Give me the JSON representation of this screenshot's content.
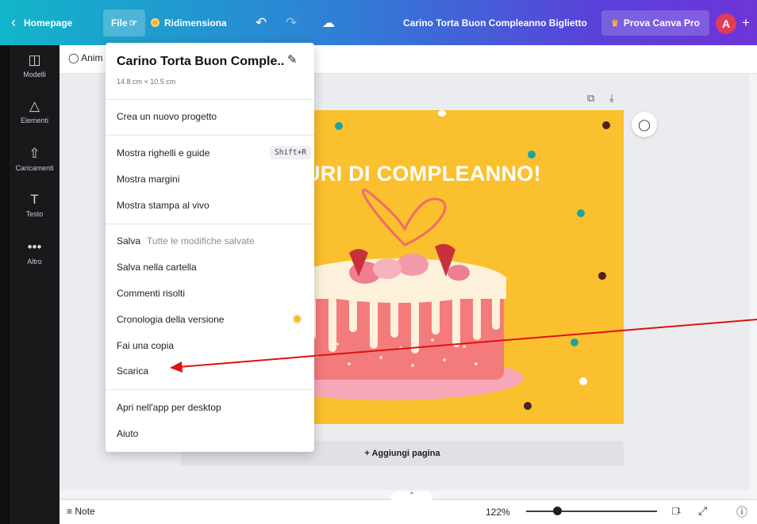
{
  "topbar": {
    "home_label": "Homepage",
    "file_label": "File",
    "resize_label": "Ridimensiona",
    "design_title": "Carino Torta Buon Compleanno Biglietto",
    "pro_label": "Prova Canva Pro",
    "avatar_initial": "A",
    "plus": "+"
  },
  "sidebar": {
    "items": [
      {
        "label": "Modelli",
        "icon": "layout-icon"
      },
      {
        "label": "Elementi",
        "icon": "shapes-icon"
      },
      {
        "label": "Caricamenti",
        "icon": "upload-icon"
      },
      {
        "label": "Testo",
        "icon": "text-icon"
      },
      {
        "label": "Altro",
        "icon": "more-icon"
      }
    ]
  },
  "subbar": {
    "animate_label": "Anim"
  },
  "menu": {
    "title": "Carino Torta Buon Comple..",
    "size": "14.8 cm × 10.5 cm",
    "items": [
      {
        "label": "Crea un nuovo progetto"
      },
      {
        "label": "Mostra righelli e guide",
        "shortcut": "Shift+R"
      },
      {
        "label": "Mostra margini"
      },
      {
        "label": "Mostra stampa al vivo"
      },
      {
        "label": "Salva",
        "sub": "Tutte le modifiche salvate"
      },
      {
        "label": "Salva nella cartella"
      },
      {
        "label": "Commenti risolti"
      },
      {
        "label": "Cronologia della versione"
      },
      {
        "label": "Fai una copia"
      },
      {
        "label": "Scarica"
      },
      {
        "label": "Apri nell'app per desktop"
      },
      {
        "label": "Aiuto"
      }
    ]
  },
  "canvas": {
    "headline": "URI DI COMPLEANNO!",
    "add_page": "+ Aggiungi pagina",
    "background_color": "#fbc02d"
  },
  "bottombar": {
    "note_label": "Note",
    "zoom": "122%",
    "page_number": "1"
  },
  "colors": {
    "annotation_arrow": "#e01010",
    "cake_body": "#f47b7b",
    "frosting": "#fdf1dc"
  }
}
